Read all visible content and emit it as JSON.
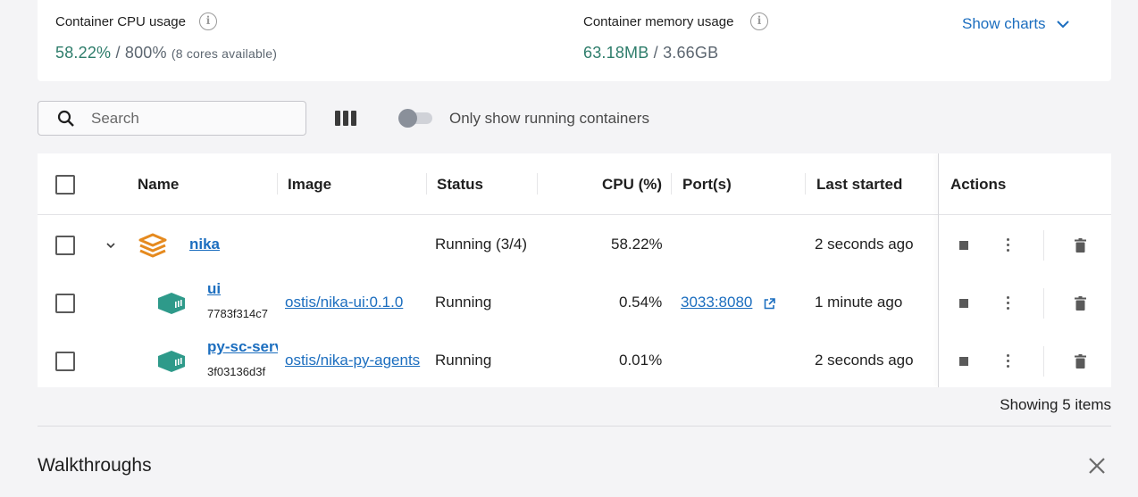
{
  "stats": {
    "cpu_label": "Container CPU usage",
    "cpu_value": "58.22%",
    "cpu_sep": " / ",
    "cpu_total": "800%",
    "cpu_note": "(8 cores available)",
    "mem_label": "Container memory usage",
    "mem_value": "63.18MB",
    "mem_sep": " / ",
    "mem_total": "3.66GB",
    "show_charts": "Show charts"
  },
  "toolbar": {
    "search_placeholder": "Search",
    "toggle_label": "Only show running containers"
  },
  "table": {
    "headers": {
      "name": "Name",
      "image": "Image",
      "status": "Status",
      "cpu": "CPU (%)",
      "ports": "Port(s)",
      "last_started": "Last started",
      "actions": "Actions"
    },
    "rows": [
      {
        "name": "nika",
        "id": "",
        "image": "",
        "status": "Running (3/4)",
        "cpu": "58.22%",
        "ports": "",
        "last_started": "2 seconds ago"
      },
      {
        "name": "ui",
        "id": "7783f314c7",
        "image": "ostis/nika-ui:0.1.0",
        "status": "Running",
        "cpu": "0.54%",
        "ports": "3033:8080",
        "last_started": "1 minute ago"
      },
      {
        "name": "py-sc-server",
        "id": "3f03136d3f",
        "image": "ostis/nika-py-agents",
        "status": "Running",
        "cpu": "0.01%",
        "ports": "",
        "last_started": "2 seconds ago"
      }
    ],
    "footer": "Showing 5 items"
  },
  "walkthroughs": {
    "title": "Walkthroughs"
  },
  "colors": {
    "accent_blue": "#1c6ebf",
    "accent_green": "#2e7d6b",
    "compose_orange": "#e58a1f",
    "container_teal": "#2e9a8a"
  }
}
